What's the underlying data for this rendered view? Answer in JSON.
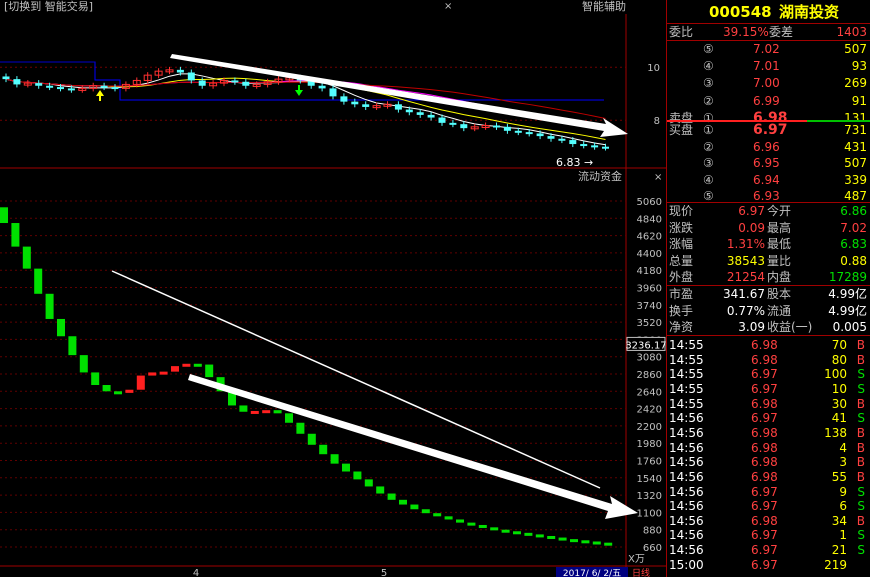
{
  "topbar": {
    "left_label": "[切换到 智能交易]",
    "close_glyph": "×",
    "right_label": "智能辅助"
  },
  "upper_chart": {
    "price_ticks": [
      "10",
      "8"
    ],
    "last_price_label": "6.83"
  },
  "lower_chart": {
    "title": "流动资金",
    "close_glyph": "×",
    "y_ticks": [
      "5060",
      "4840",
      "4620",
      "4400",
      "4180",
      "3960",
      "3740",
      "3520",
      "3300",
      "3080",
      "2860",
      "2640",
      "2420",
      "2200",
      "1980",
      "1760",
      "1540",
      "1320",
      "1100",
      "880",
      "660"
    ],
    "current_value": "3236.17",
    "unit": "X万",
    "x_labels": [
      "4",
      "5"
    ],
    "date_label": "2017/ 6/ 2/五",
    "period_label": "日线"
  },
  "stock": {
    "code": "000548",
    "name": "湖南投资"
  },
  "ratio": {
    "label1": "委比",
    "value1": "39.15%",
    "label2": "委差",
    "value2": "1403"
  },
  "sell_orders": [
    {
      "label": "⑤",
      "price": "7.02",
      "vol": "507"
    },
    {
      "label": "④",
      "price": "7.01",
      "vol": "93"
    },
    {
      "label": "③",
      "price": "7.00",
      "vol": "269"
    },
    {
      "label": "②",
      "price": "6.99",
      "vol": "91"
    },
    {
      "label": "①",
      "price": "6.98",
      "vol": "131",
      "prefix": "卖盘"
    }
  ],
  "buy_orders": [
    {
      "label": "①",
      "price": "6.97",
      "vol": "731",
      "prefix": "买盘"
    },
    {
      "label": "②",
      "price": "6.96",
      "vol": "431"
    },
    {
      "label": "③",
      "price": "6.95",
      "vol": "507"
    },
    {
      "label": "④",
      "price": "6.94",
      "vol": "339"
    },
    {
      "label": "⑤",
      "price": "6.93",
      "vol": "487"
    }
  ],
  "quote": [
    {
      "l1": "现价",
      "v1": "6.97",
      "c1": "red",
      "l2": "今开",
      "v2": "6.86",
      "c2": "green"
    },
    {
      "l1": "涨跌",
      "v1": "0.09",
      "c1": "red",
      "l2": "最高",
      "v2": "7.02",
      "c2": "red"
    },
    {
      "l1": "涨幅",
      "v1": "1.31%",
      "c1": "red",
      "l2": "最低",
      "v2": "6.83",
      "c2": "green"
    },
    {
      "l1": "总量",
      "v1": "38543",
      "c1": "yellow",
      "l2": "量比",
      "v2": "0.88",
      "c2": "yellow"
    },
    {
      "l1": "外盘",
      "v1": "21254",
      "c1": "red",
      "l2": "内盘",
      "v2": "17289",
      "c2": "green"
    }
  ],
  "fundamentals": [
    {
      "l1": "市盈",
      "v1": "341.67",
      "l2": "股本",
      "v2": "4.99亿"
    },
    {
      "l1": "换手",
      "v1": "0.77%",
      "l2": "流通",
      "v2": "4.99亿"
    },
    {
      "l1": "净资",
      "v1": "3.09",
      "l2": "收益(一)",
      "v2": "0.005"
    }
  ],
  "ticks": [
    {
      "time": "14:55",
      "price": "6.98",
      "vol": "70",
      "side": "B"
    },
    {
      "time": "14:55",
      "price": "6.98",
      "vol": "80",
      "side": "B"
    },
    {
      "time": "14:55",
      "price": "6.97",
      "vol": "100",
      "side": "S"
    },
    {
      "time": "14:55",
      "price": "6.97",
      "vol": "10",
      "side": "S"
    },
    {
      "time": "14:55",
      "price": "6.98",
      "vol": "30",
      "side": "B"
    },
    {
      "time": "14:56",
      "price": "6.97",
      "vol": "41",
      "side": "S"
    },
    {
      "time": "14:56",
      "price": "6.98",
      "vol": "138",
      "side": "B"
    },
    {
      "time": "14:56",
      "price": "6.98",
      "vol": "4",
      "side": "B"
    },
    {
      "time": "14:56",
      "price": "6.98",
      "vol": "3",
      "side": "B"
    },
    {
      "time": "14:56",
      "price": "6.98",
      "vol": "55",
      "side": "B"
    },
    {
      "time": "14:56",
      "price": "6.97",
      "vol": "9",
      "side": "S"
    },
    {
      "time": "14:56",
      "price": "6.97",
      "vol": "6",
      "side": "S"
    },
    {
      "time": "14:56",
      "price": "6.98",
      "vol": "34",
      "side": "B"
    },
    {
      "time": "14:56",
      "price": "6.97",
      "vol": "1",
      "side": "S"
    },
    {
      "time": "14:56",
      "price": "6.97",
      "vol": "21",
      "side": "S"
    },
    {
      "time": "15:00",
      "price": "6.97",
      "vol": "219",
      "side": ""
    }
  ],
  "chart_data": [
    {
      "type": "candlestick",
      "title": "",
      "y_ticks": [
        10,
        8
      ],
      "values": [
        9.55,
        9.35,
        9.4,
        9.3,
        9.25,
        9.2,
        9.15,
        9.2,
        9.3,
        9.25,
        9.2,
        9.35,
        9.5,
        9.7,
        9.85,
        9.9,
        9.8,
        9.5,
        9.3,
        9.4,
        9.5,
        9.45,
        9.3,
        9.35,
        9.45,
        9.55,
        9.6,
        9.5,
        9.3,
        9.2,
        8.9,
        8.7,
        8.6,
        8.5,
        8.55,
        8.6,
        8.4,
        8.3,
        8.2,
        8.1,
        7.9,
        7.85,
        7.7,
        7.75,
        7.8,
        7.75,
        7.6,
        7.55,
        7.5,
        7.4,
        7.3,
        7.25,
        7.1,
        7.05,
        7.0,
        6.97
      ],
      "annotations": [
        "6.83"
      ]
    },
    {
      "type": "bar",
      "title": "流动资金",
      "unit": "X万",
      "ylim": [
        660,
        5060
      ],
      "values": [
        4780,
        4480,
        4200,
        3880,
        3560,
        3340,
        3100,
        2880,
        2720,
        2640,
        2620,
        2660,
        2840,
        2880,
        2890,
        2960,
        2990,
        2980,
        2820,
        2640,
        2460,
        2380,
        2390,
        2400,
        2360,
        2240,
        2100,
        1960,
        1840,
        1720,
        1620,
        1520,
        1430,
        1340,
        1260,
        1200,
        1140,
        1090,
        1050,
        1010,
        970,
        940,
        910,
        880,
        860,
        840,
        820,
        800,
        780,
        760,
        745,
        730,
        715,
        700
      ],
      "current": 3236.17
    }
  ]
}
